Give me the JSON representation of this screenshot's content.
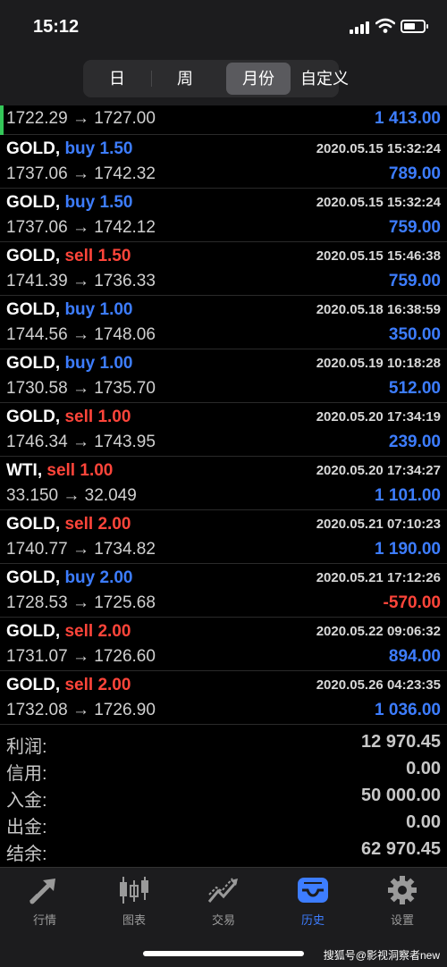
{
  "status": {
    "time": "15:12"
  },
  "segments": [
    {
      "label": "日",
      "active": false
    },
    {
      "label": "周",
      "active": false
    },
    {
      "label": "月份",
      "active": true
    },
    {
      "label": "自定义",
      "active": false
    }
  ],
  "first_row": {
    "price": "1722.29 → 1727.00",
    "profit": "1 413.00"
  },
  "trades": [
    {
      "symbol": "GOLD,",
      "side": "buy",
      "volume": "1.50",
      "date": "2020.05.15 15:32:24",
      "price": "1737.06 → 1742.32",
      "profit": "789.00"
    },
    {
      "symbol": "GOLD,",
      "side": "buy",
      "volume": "1.50",
      "date": "2020.05.15 15:32:24",
      "price": "1737.06 → 1742.12",
      "profit": "759.00"
    },
    {
      "symbol": "GOLD,",
      "side": "sell",
      "volume": "1.50",
      "date": "2020.05.15 15:46:38",
      "price": "1741.39 → 1736.33",
      "profit": "759.00"
    },
    {
      "symbol": "GOLD,",
      "side": "buy",
      "volume": "1.00",
      "date": "2020.05.18 16:38:59",
      "price": "1744.56 → 1748.06",
      "profit": "350.00"
    },
    {
      "symbol": "GOLD,",
      "side": "buy",
      "volume": "1.00",
      "date": "2020.05.19 10:18:28",
      "price": "1730.58 → 1735.70",
      "profit": "512.00"
    },
    {
      "symbol": "GOLD,",
      "side": "sell",
      "volume": "1.00",
      "date": "2020.05.20 17:34:19",
      "price": "1746.34 → 1743.95",
      "profit": "239.00"
    },
    {
      "symbol": "WTI,",
      "side": "sell",
      "volume": "1.00",
      "date": "2020.05.20 17:34:27",
      "price": "33.150 → 32.049",
      "profit": "1 101.00"
    },
    {
      "symbol": "GOLD,",
      "side": "sell",
      "volume": "2.00",
      "date": "2020.05.21 07:10:23",
      "price": "1740.77 → 1734.82",
      "profit": "1 190.00"
    },
    {
      "symbol": "GOLD,",
      "side": "buy",
      "volume": "2.00",
      "date": "2020.05.21 17:12:26",
      "price": "1728.53 → 1725.68",
      "profit": "-570.00"
    },
    {
      "symbol": "GOLD,",
      "side": "sell",
      "volume": "2.00",
      "date": "2020.05.22 09:06:32",
      "price": "1731.07 → 1726.60",
      "profit": "894.00"
    },
    {
      "symbol": "GOLD,",
      "side": "sell",
      "volume": "2.00",
      "date": "2020.05.26 04:23:35",
      "price": "1732.08 → 1726.90",
      "profit": "1 036.00"
    }
  ],
  "summary": [
    {
      "label": "利润:",
      "value": "12 970.45"
    },
    {
      "label": "信用:",
      "value": "0.00"
    },
    {
      "label": "入金:",
      "value": "50 000.00"
    },
    {
      "label": "出金:",
      "value": "0.00"
    },
    {
      "label": "结余:",
      "value": "62 970.45"
    }
  ],
  "tabs": [
    {
      "label": "行情",
      "icon": "quotes-arrows-icon",
      "active": false
    },
    {
      "label": "图表",
      "icon": "candlestick-chart-icon",
      "active": false
    },
    {
      "label": "交易",
      "icon": "trade-trend-icon",
      "active": false
    },
    {
      "label": "历史",
      "icon": "history-inbox-icon",
      "active": true
    },
    {
      "label": "设置",
      "icon": "gear-icon",
      "active": false
    }
  ],
  "watermark": "搜狐号@影视洞察者new",
  "colors": {
    "buy": "#3d7dff",
    "sell": "#ff453a",
    "profit_positive": "#3d7dff",
    "profit_negative": "#ff453a",
    "active_tab": "#3d7dff"
  }
}
